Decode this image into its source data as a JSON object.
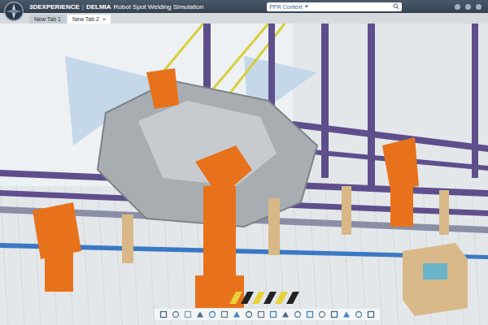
{
  "header": {
    "brand": "3DEXPERIENCE",
    "separator": "|",
    "app": "DELMIA",
    "title": "Robot Spot Welding Simulation"
  },
  "search": {
    "context": "PPR Context",
    "dropdown": "▾"
  },
  "tabs": [
    {
      "label": "New Tab 1",
      "selected": false,
      "close": ""
    },
    {
      "label": "New Tab 2",
      "selected": true,
      "close": "×"
    }
  ]
}
